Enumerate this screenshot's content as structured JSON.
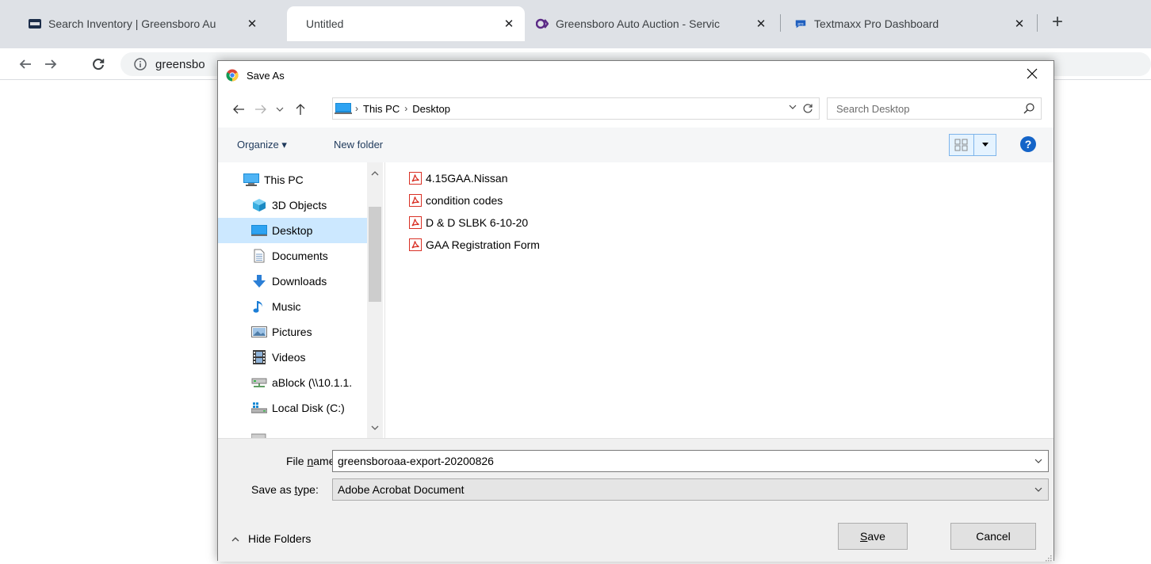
{
  "browser": {
    "tabs": [
      {
        "title": "Search Inventory | Greensboro Au",
        "favicon": "gaa-logo-icon"
      },
      {
        "title": "Untitled",
        "favicon": "none"
      },
      {
        "title": "Greensboro Auto Auction - Servic",
        "favicon": "q-logo-icon"
      },
      {
        "title": "Textmaxx Pro Dashboard",
        "favicon": "textmaxx-pro-icon"
      }
    ],
    "new_tab_label": "+",
    "address_text": "greensbo"
  },
  "dialog": {
    "title": "Save As",
    "breadcrumb": [
      "This PC",
      "Desktop"
    ],
    "search_placeholder": "Search Desktop",
    "commands": {
      "organize": "Organize ▾",
      "new_folder": "New folder"
    },
    "help_label": "?",
    "nav_items": [
      {
        "label": "This PC",
        "icon": "computer-icon",
        "selected": false
      },
      {
        "label": "3D Objects",
        "icon": "cube-icon",
        "selected": false
      },
      {
        "label": "Desktop",
        "icon": "desktop-icon",
        "selected": true
      },
      {
        "label": "Documents",
        "icon": "document-icon",
        "selected": false
      },
      {
        "label": "Downloads",
        "icon": "download-arrow-icon",
        "selected": false
      },
      {
        "label": "Music",
        "icon": "music-note-icon",
        "selected": false
      },
      {
        "label": "Pictures",
        "icon": "picture-icon",
        "selected": false
      },
      {
        "label": "Videos",
        "icon": "film-icon",
        "selected": false
      },
      {
        "label": "aBlock (\\\\10.1.1.",
        "icon": "network-drive-icon",
        "selected": false
      },
      {
        "label": "Local Disk (C:)",
        "icon": "hard-drive-icon",
        "selected": false
      }
    ],
    "files": [
      {
        "name": "4.15GAA.Nissan",
        "icon": "pdf-icon"
      },
      {
        "name": "condition codes",
        "icon": "pdf-icon"
      },
      {
        "name": "D & D SLBK 6-10-20",
        "icon": "pdf-icon"
      },
      {
        "name": "GAA Registration Form",
        "icon": "pdf-icon"
      }
    ],
    "file_name_label_pre": "File ",
    "file_name_label_ul": "n",
    "file_name_label_post": "ame:",
    "file_name_value": "greensboroaa-export-20200826",
    "save_type_label_pre": "Save as ",
    "save_type_label_ul": "t",
    "save_type_label_post": "ype:",
    "save_type_value": "Adobe Acrobat Document",
    "hide_folders_label": "Hide Folders",
    "save_button_ul": "S",
    "save_button_rest": "ave",
    "cancel_button": "Cancel"
  },
  "colors": {
    "selection": "#cce8ff",
    "accent": "#0078d7",
    "pdf_red": "#d93025",
    "help_blue": "#1464c8"
  }
}
